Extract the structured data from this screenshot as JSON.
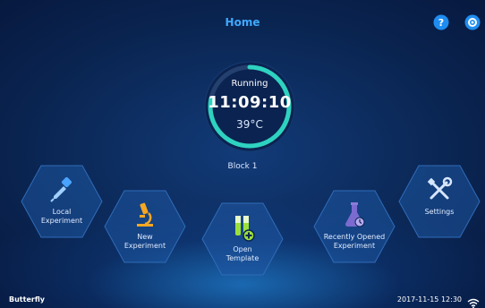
{
  "header": {
    "title": "Home",
    "help_icon": "help-icon",
    "settings_icon": "gear-icon"
  },
  "status_dial": {
    "state": "Running",
    "time": "11:09:10",
    "temperature": "39°C",
    "progress": 0.78,
    "block_label": "Block 1"
  },
  "menu": {
    "local_experiment": {
      "label_line1": "Local",
      "label_line2": "Experiment",
      "icon": "pipette-icon"
    },
    "new_experiment": {
      "label_line1": "New",
      "label_line2": "Experiment",
      "icon": "microscope-icon"
    },
    "open_template": {
      "label_line1": "Open",
      "label_line2": "Template",
      "icon": "test-tubes-icon"
    },
    "recently_opened": {
      "label_line1": "Recently Opened",
      "label_line2": "Experiment",
      "icon": "flask-icon"
    },
    "settings": {
      "label_line1": "Settings",
      "label_line2": "",
      "icon": "tools-icon"
    }
  },
  "footer": {
    "device_name": "Butterfly",
    "datetime": "2017-11-15  12:30",
    "wifi_icon": "wifi-icon"
  },
  "colors": {
    "accent": "#3fa9ff",
    "dial_progress": "#2ed3c0",
    "background": "#0a2552"
  }
}
